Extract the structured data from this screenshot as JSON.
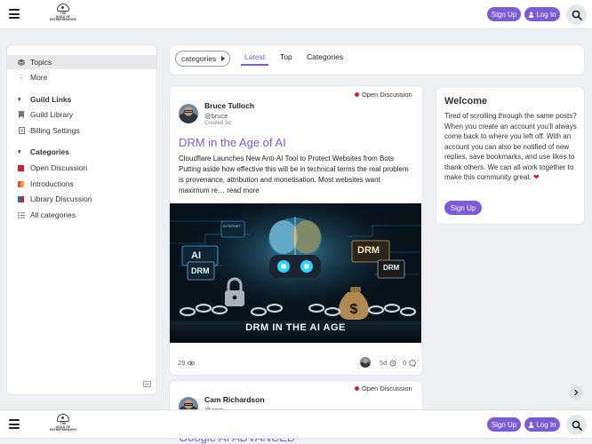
{
  "header": {
    "logo_text_1": "THE",
    "logo_text_2": "GUILD OF",
    "logo_text_3": "ENTREPRENEURS",
    "signup_label": "Sign Up",
    "login_label": "Log In",
    "accent": "#7b5cd6"
  },
  "sidebar": {
    "topics_label": "Topics",
    "more_label": "More",
    "guild_links_heading": "Guild Links",
    "guild_library_label": "Guild Library",
    "billing_label": "Billing Settings",
    "categories_heading": "Categories",
    "categories": [
      {
        "label": "Open Discussion",
        "color": "#d01f2a"
      },
      {
        "label": "Introductions",
        "color": "#e45735"
      },
      {
        "label": "Library Discussion",
        "color": "#0e76bd"
      },
      {
        "label": "All categories",
        "color": ""
      }
    ]
  },
  "nav": {
    "categories_dropdown": "categories",
    "tabs": [
      "Latest",
      "Top",
      "Categories"
    ]
  },
  "topics": [
    {
      "category": "Open Discussion",
      "author": "Bruce Tulloch",
      "handle": "@bruce",
      "created": "Created 5d",
      "title": "DRM in the Age of AI",
      "excerpt": "Cloudflare Launches New Anti-AI Tool to Protect Websites from Bots Putting aside how effective this will be in technical terms the real problem is provenance, attribution and monetisation. Most websites want maximum re… ",
      "read_more": "read more",
      "image_caption": "DRM IN THE AI AGE",
      "views": "29",
      "activity": "5d",
      "replies": "0"
    },
    {
      "category": "Open Discussion",
      "author": "Cam Richardson",
      "handle": "@cam",
      "title_partial": "Google AI ADVANCED"
    }
  ],
  "hero_labels": {
    "internet": "INTERNET",
    "ai": "AI",
    "drm": "DRM"
  },
  "welcome": {
    "title": "Welcome",
    "body": "Tired of scrolling through the same posts? When you create an account you'll always come back to where you left off. With an account you can also be notified of new replies, save bookmarks, and use likes to thank others. We can all work together to make this community great.",
    "signup_label": "Sign Up"
  }
}
